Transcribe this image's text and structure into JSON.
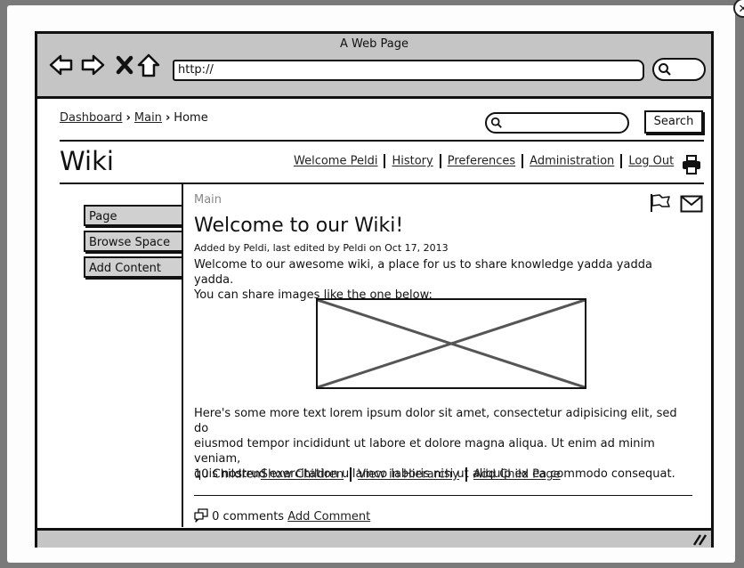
{
  "window": {
    "title": "A Web Page",
    "url": "http://"
  },
  "breadcrumb": {
    "items": [
      "Dashboard",
      "Main"
    ],
    "current": "Home"
  },
  "search": {
    "button_label": "Search"
  },
  "header": {
    "title": "Wiki",
    "links": [
      "Welcome Peldi",
      "History",
      "Preferences",
      "Administration",
      "Log Out"
    ]
  },
  "sidebar": {
    "buttons": [
      "Page Operations",
      "Browse Space",
      "Add Content"
    ]
  },
  "page": {
    "section": "Main",
    "title": "Welcome to our Wiki!",
    "meta": "Added by Peldi, last edited by Peldi on Oct 17, 2013",
    "intro_line1": "Welcome to our awesome wiki, a place for us to share knowledge yadda yadda yadda.",
    "intro_line2": "You can share images like the one below:",
    "body_line1": "Here's some more text lorem ipsum dolor sit amet, consectetur adipisicing elit, sed do",
    "body_line2": "eiusmod tempor incididunt ut labore et dolore magna aliqua. Ut enim ad minim veniam,",
    "body_line3": "quis nostrud exercitation ullamco laboris nisi ut aliquip ex ea commodo consequat.",
    "children_count": "10 Children",
    "children_links": [
      "Show Children",
      "View in Hierarchy",
      "Add Child Page"
    ],
    "comments_count": "0 comments",
    "add_comment": "Add Comment"
  },
  "icons": {
    "nav": [
      "back-arrow-icon",
      "forward-arrow-icon",
      "stop-icon",
      "home-icon"
    ],
    "other": [
      "search-icon",
      "print-icon",
      "flag-icon",
      "mail-icon",
      "comments-icon",
      "resize-grip-icon"
    ]
  }
}
